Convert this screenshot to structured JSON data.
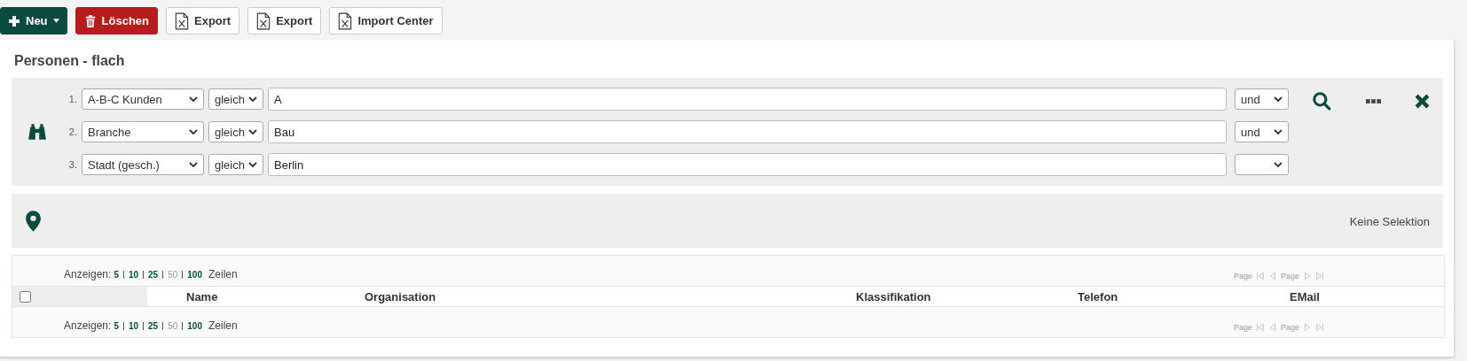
{
  "toolbar": [
    {
      "kind": "new",
      "label": "Neu"
    },
    {
      "kind": "delete",
      "label": "Löschen"
    },
    {
      "kind": "file",
      "label": "Export"
    },
    {
      "kind": "file",
      "label": "Export"
    },
    {
      "kind": "file",
      "label": "Import Center"
    }
  ],
  "title": "Personen - flach",
  "filters": [
    {
      "index": "1.",
      "field": "A-B-C Kunden",
      "operator": "gleich",
      "value": "A",
      "conjunction": "und"
    },
    {
      "index": "2.",
      "field": "Branche",
      "operator": "gleich",
      "value": "Bau",
      "conjunction": "und"
    },
    {
      "index": "3.",
      "field": "Stadt (gesch.)",
      "operator": "gleich",
      "value": "Berlin"
    }
  ],
  "map": {
    "status": "Keine Selektion"
  },
  "table": {
    "pagers": [
      {
        "label": "Anzeigen:",
        "sizes": [
          {
            "label": "5",
            "selected": false
          },
          {
            "label": "10",
            "selected": false
          },
          {
            "label": "25",
            "selected": false
          },
          {
            "label": "50",
            "selected": true
          },
          {
            "label": "100",
            "selected": false
          }
        ],
        "suffix": "Zeilen",
        "page_labels": [
          "Page",
          "Page"
        ]
      },
      {
        "label": "Anzeigen:",
        "sizes": [
          {
            "label": "5",
            "selected": false
          },
          {
            "label": "10",
            "selected": false
          },
          {
            "label": "25",
            "selected": false
          },
          {
            "label": "50",
            "selected": true
          },
          {
            "label": "100",
            "selected": false
          }
        ],
        "suffix": "Zeilen",
        "page_labels": [
          "Page",
          "Page"
        ]
      }
    ],
    "select_all": {
      "checked": false
    },
    "columns": [
      "Name",
      "Organisation",
      "Klassifikation",
      "Telefon",
      "EMail"
    ]
  }
}
